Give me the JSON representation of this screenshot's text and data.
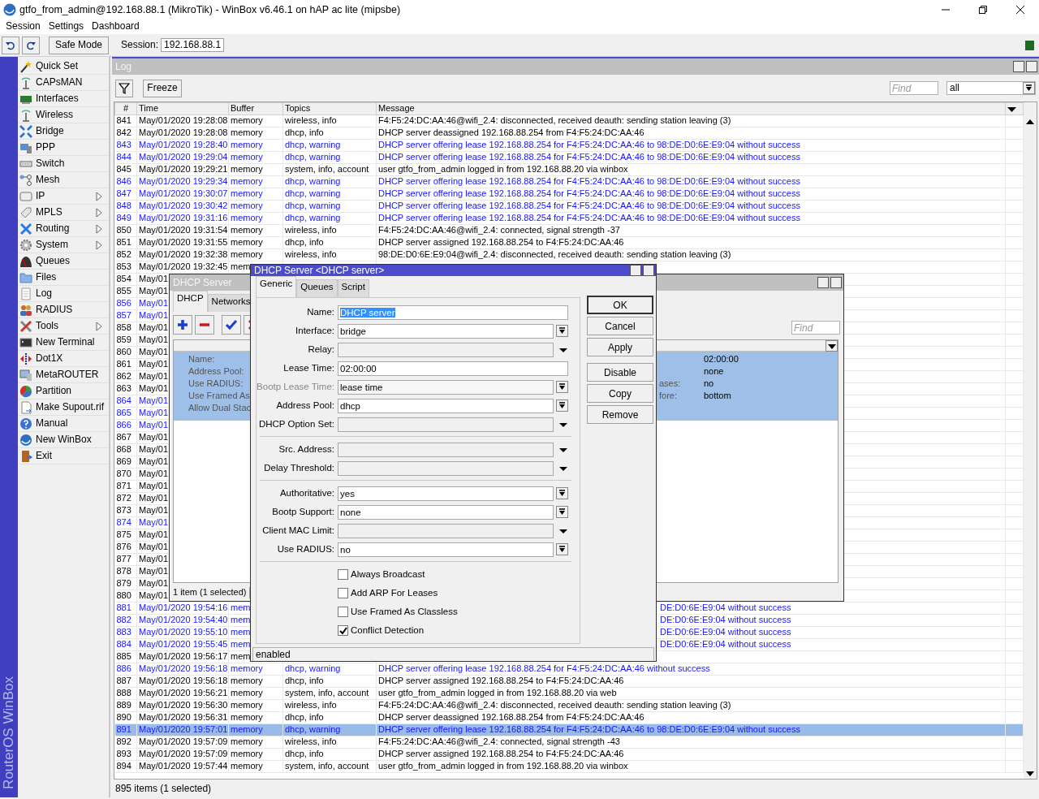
{
  "app": {
    "title": "gtfo_from_admin@192.168.88.1 (MikroTik) - WinBox v6.46.1 on hAP ac lite (mipsbe)",
    "menu": [
      "Session",
      "Settings",
      "Dashboard"
    ],
    "toolbar": {
      "safe_mode": "Safe Mode",
      "session_label": "Session:",
      "session_value": "192.168.88.1"
    },
    "brand_strip": "RouterOS WinBox"
  },
  "sidebar": {
    "items": [
      {
        "label": "Quick Set",
        "submenu": false
      },
      {
        "label": "CAPsMAN",
        "submenu": false
      },
      {
        "label": "Interfaces",
        "submenu": false
      },
      {
        "label": "Wireless",
        "submenu": false
      },
      {
        "label": "Bridge",
        "submenu": false
      },
      {
        "label": "PPP",
        "submenu": false
      },
      {
        "label": "Switch",
        "submenu": false
      },
      {
        "label": "Mesh",
        "submenu": false
      },
      {
        "label": "IP",
        "submenu": true
      },
      {
        "label": "MPLS",
        "submenu": true
      },
      {
        "label": "Routing",
        "submenu": true
      },
      {
        "label": "System",
        "submenu": true
      },
      {
        "label": "Queues",
        "submenu": false
      },
      {
        "label": "Files",
        "submenu": false
      },
      {
        "label": "Log",
        "submenu": false
      },
      {
        "label": "RADIUS",
        "submenu": false
      },
      {
        "label": "Tools",
        "submenu": true
      },
      {
        "label": "New Terminal",
        "submenu": false
      },
      {
        "label": "Dot1X",
        "submenu": false
      },
      {
        "label": "MetaROUTER",
        "submenu": false
      },
      {
        "label": "Partition",
        "submenu": false
      },
      {
        "label": "Make Supout.rif",
        "submenu": false
      },
      {
        "label": "Manual",
        "submenu": false
      },
      {
        "label": "New WinBox",
        "submenu": false
      },
      {
        "label": "Exit",
        "submenu": false
      }
    ]
  },
  "log_window": {
    "title": "Log",
    "freeze": "Freeze",
    "find_placeholder": "Find",
    "filter_value": "all",
    "columns": [
      "#",
      "Time",
      "Buffer",
      "Topics",
      "Message"
    ],
    "status": "895 items (1 selected)",
    "rows": [
      {
        "number": "841",
        "time": "May/01/2020 19:28:08",
        "buffer": "memory",
        "topics": "wireless, info",
        "message": "F4:F5:24:DC:AA:46@wifi_2.4: disconnected, received deauth: sending station leaving (3)",
        "kind": "info",
        "selected": false
      },
      {
        "number": "842",
        "time": "May/01/2020 19:28:08",
        "buffer": "memory",
        "topics": "dhcp, info",
        "message": "DHCP server deassigned 192.168.88.254 from F4:F5:24:DC:AA:46",
        "kind": "info",
        "selected": false
      },
      {
        "number": "843",
        "time": "May/01/2020 19:28:40",
        "buffer": "memory",
        "topics": "dhcp, warning",
        "message": "DHCP server offering lease 192.168.88.254 for F4:F5:24:DC:AA:46 to 98:DE:D0:6E:E9:04 without success",
        "kind": "warning",
        "selected": false
      },
      {
        "number": "844",
        "time": "May/01/2020 19:29:04",
        "buffer": "memory",
        "topics": "dhcp, warning",
        "message": "DHCP server offering lease 192.168.88.254 for F4:F5:24:DC:AA:46 to 98:DE:D0:6E:E9:04 without success",
        "kind": "warning",
        "selected": false
      },
      {
        "number": "845",
        "time": "May/01/2020 19:29:21",
        "buffer": "memory",
        "topics": "system, info, account",
        "message": "user gtfo_from_admin logged in from 192.168.88.20 via winbox",
        "kind": "info",
        "selected": false
      },
      {
        "number": "846",
        "time": "May/01/2020 19:29:34",
        "buffer": "memory",
        "topics": "dhcp, warning",
        "message": "DHCP server offering lease 192.168.88.254 for F4:F5:24:DC:AA:46 to 98:DE:D0:6E:E9:04 without success",
        "kind": "warning",
        "selected": false
      },
      {
        "number": "847",
        "time": "May/01/2020 19:30:07",
        "buffer": "memory",
        "topics": "dhcp, warning",
        "message": "DHCP server offering lease 192.168.88.254 for F4:F5:24:DC:AA:46 to 98:DE:D0:6E:E9:04 without success",
        "kind": "warning",
        "selected": false
      },
      {
        "number": "848",
        "time": "May/01/2020 19:30:42",
        "buffer": "memory",
        "topics": "dhcp, warning",
        "message": "DHCP server offering lease 192.168.88.254 for F4:F5:24:DC:AA:46 to 98:DE:D0:6E:E9:04 without success",
        "kind": "warning",
        "selected": false
      },
      {
        "number": "849",
        "time": "May/01/2020 19:31:16",
        "buffer": "memory",
        "topics": "dhcp, warning",
        "message": "DHCP server offering lease 192.168.88.254 for F4:F5:24:DC:AA:46 to 98:DE:D0:6E:E9:04 without success",
        "kind": "warning",
        "selected": false
      },
      {
        "number": "850",
        "time": "May/01/2020 19:31:54",
        "buffer": "memory",
        "topics": "wireless, info",
        "message": "F4:F5:24:DC:AA:46@wifi_2.4: connected, signal strength -37",
        "kind": "info",
        "selected": false
      },
      {
        "number": "851",
        "time": "May/01/2020 19:31:55",
        "buffer": "memory",
        "topics": "dhcp, info",
        "message": "DHCP server assigned 192.168.88.254 to F4:F5:24:DC:AA:46",
        "kind": "info",
        "selected": false
      },
      {
        "number": "852",
        "time": "May/01/2020 19:32:38",
        "buffer": "memory",
        "topics": "wireless, info",
        "message": "98:DE:D0:6E:E9:04@wifi_2.4: disconnected, received deauth: sending station leaving (3)",
        "kind": "info",
        "selected": false
      },
      {
        "number": "853",
        "time": "May/01/2020 19:32:45",
        "buffer": "mem",
        "kind": "info",
        "selected": false
      },
      {
        "number": "854",
        "time": "May/01",
        "kind": "info",
        "selected": false
      },
      {
        "number": "855",
        "time": "May/01",
        "kind": "info",
        "selected": false
      },
      {
        "number": "856",
        "time": "May/01",
        "kind": "warning",
        "selected": false
      },
      {
        "number": "857",
        "time": "May/01",
        "kind": "warning",
        "selected": false
      },
      {
        "number": "858",
        "time": "May/01",
        "kind": "info",
        "selected": false
      },
      {
        "number": "859",
        "time": "May/01",
        "kind": "info",
        "selected": false
      },
      {
        "number": "860",
        "time": "May/01",
        "kind": "info",
        "selected": false
      },
      {
        "number": "861",
        "time": "May/01",
        "kind": "info",
        "selected": false
      },
      {
        "number": "862",
        "time": "May/01",
        "kind": "info",
        "selected": false
      },
      {
        "number": "863",
        "time": "May/01",
        "kind": "info",
        "selected": false
      },
      {
        "number": "864",
        "time": "May/01",
        "kind": "warning",
        "selected": false
      },
      {
        "number": "865",
        "time": "May/01",
        "kind": "warning",
        "selected": false
      },
      {
        "number": "866",
        "time": "May/01",
        "kind": "warning",
        "selected": false
      },
      {
        "number": "867",
        "time": "May/01",
        "kind": "info",
        "selected": false
      },
      {
        "number": "868",
        "time": "May/01",
        "kind": "info",
        "selected": false
      },
      {
        "number": "869",
        "time": "May/01",
        "kind": "info",
        "selected": false
      },
      {
        "number": "870",
        "time": "May/01",
        "kind": "info",
        "selected": false
      },
      {
        "number": "871",
        "time": "May/01",
        "kind": "info",
        "selected": false
      },
      {
        "number": "872",
        "time": "May/01",
        "kind": "info",
        "selected": false
      },
      {
        "number": "873",
        "time": "May/01",
        "kind": "info",
        "selected": false
      },
      {
        "number": "874",
        "time": "May/01",
        "kind": "warning",
        "selected": false
      },
      {
        "number": "875",
        "time": "May/01",
        "kind": "info",
        "selected": false
      },
      {
        "number": "876",
        "time": "May/01",
        "kind": "info",
        "selected": false
      },
      {
        "number": "877",
        "time": "May/01",
        "kind": "info",
        "selected": false
      },
      {
        "number": "878",
        "time": "May/01",
        "kind": "info",
        "selected": false
      },
      {
        "number": "879",
        "time": "May/01",
        "kind": "info",
        "selected": false
      },
      {
        "number": "880",
        "time": "May/01",
        "kind": "info",
        "selected": false
      },
      {
        "number": "881",
        "time": "May/01/2020 19:54:16",
        "buffer": "mem",
        "message": "DE:D0:6E:E9:04 without success",
        "kind": "warning",
        "selected": false
      },
      {
        "number": "882",
        "time": "May/01/2020 19:54:40",
        "buffer": "mem",
        "message": "DE:D0:6E:E9:04 without success",
        "kind": "warning",
        "selected": false
      },
      {
        "number": "883",
        "time": "May/01/2020 19:55:10",
        "buffer": "mem",
        "message": "DE:D0:6E:E9:04 without success",
        "kind": "warning",
        "selected": false
      },
      {
        "number": "884",
        "time": "May/01/2020 19:55:45",
        "buffer": "mem",
        "message": "DE:D0:6E:E9:04 without success",
        "kind": "warning",
        "selected": false
      },
      {
        "number": "885",
        "time": "May/01/2020 19:56:17",
        "buffer": "mem",
        "kind": "info",
        "selected": false
      },
      {
        "number": "886",
        "time": "May/01/2020 19:56:18",
        "buffer": "memory",
        "topics": "dhcp, warning",
        "message": "DHCP server offering lease 192.168.88.254 for F4:F5:24:DC:AA:46 without success",
        "kind": "warning",
        "selected": false
      },
      {
        "number": "887",
        "time": "May/01/2020 19:56:18",
        "buffer": "memory",
        "topics": "dhcp, info",
        "message": "DHCP server assigned 192.168.88.254 to F4:F5:24:DC:AA:46",
        "kind": "info",
        "selected": false
      },
      {
        "number": "888",
        "time": "May/01/2020 19:56:21",
        "buffer": "memory",
        "topics": "system, info, account",
        "message": "user gtfo_from_admin logged in from 192.168.88.20 via web",
        "kind": "info",
        "selected": false
      },
      {
        "number": "889",
        "time": "May/01/2020 19:56:30",
        "buffer": "memory",
        "topics": "wireless, info",
        "message": "F4:F5:24:DC:AA:46@wifi_2.4: disconnected, received deauth: sending station leaving (3)",
        "kind": "info",
        "selected": false
      },
      {
        "number": "890",
        "time": "May/01/2020 19:56:31",
        "buffer": "memory",
        "topics": "dhcp, info",
        "message": "DHCP server deassigned 192.168.88.254 from F4:F5:24:DC:AA:46",
        "kind": "info",
        "selected": false
      },
      {
        "number": "891",
        "time": "May/01/2020 19:57:01",
        "buffer": "memory",
        "topics": "dhcp, warning",
        "message": "DHCP server offering lease 192.168.88.254 for F4:F5:24:DC:AA:46 to 98:DE:D0:6E:E9:04 without success",
        "kind": "warning",
        "selected": true
      },
      {
        "number": "892",
        "time": "May/01/2020 19:57:09",
        "buffer": "memory",
        "topics": "wireless, info",
        "message": "F4:F5:24:DC:AA:46@wifi_2.4: connected, signal strength -43",
        "kind": "info",
        "selected": false
      },
      {
        "number": "893",
        "time": "May/01/2020 19:57:09",
        "buffer": "memory",
        "topics": "dhcp, info",
        "message": "DHCP server assigned 192.168.88.254 to F4:F5:24:DC:AA:46",
        "kind": "info",
        "selected": false
      },
      {
        "number": "894",
        "time": "May/01/2020 19:57:44",
        "buffer": "memory",
        "topics": "system, info, account",
        "message": "user gtfo_from_admin logged in from 192.168.88.20 via winbox",
        "kind": "info",
        "selected": false
      }
    ]
  },
  "dhcp_server_window": {
    "title": "DHCP Server",
    "tabs": [
      {
        "label": "DHCP",
        "selected": true
      },
      {
        "label": "Networks",
        "selected": false
      }
    ],
    "find_placeholder": "Find",
    "entry_lines": [
      {
        "label": "Name:",
        "value": "02:00:00"
      },
      {
        "label": "Address Pool:",
        "value": "none"
      },
      {
        "label": "Use RADIUS:",
        "right_label": "ases:",
        "value": "no"
      },
      {
        "label": "Use Framed As",
        "right_label": "fore:",
        "value": "bottom"
      },
      {
        "label": "Allow Dual Stac"
      }
    ],
    "status": "1 item (1 selected)"
  },
  "dhcp_server_dialog": {
    "title": "DHCP Server <DHCP server>",
    "tabs": [
      {
        "label": "Generic",
        "selected": true
      },
      {
        "label": "Queues",
        "selected": false
      },
      {
        "label": "Script",
        "selected": false
      }
    ],
    "field_groups": [
      [
        {
          "label": "Name:",
          "value": "DHCP server",
          "kind": "text",
          "highlighted": true,
          "disabled": false
        },
        {
          "label": "Interface:",
          "value": "bridge",
          "kind": "combo",
          "disabled": false
        },
        {
          "label": "Relay:",
          "kind": "dropdown",
          "disabled": false
        },
        {
          "label": "Lease Time:",
          "value": "02:00:00",
          "kind": "text",
          "highlighted": false,
          "disabled": false
        },
        {
          "label": "Bootp Lease Time:",
          "value": "lease time",
          "kind": "combo",
          "disabled": true
        },
        {
          "label": "Address Pool:",
          "value": "dhcp",
          "kind": "combo",
          "disabled": false
        },
        {
          "label": "DHCP Option Set:",
          "kind": "dropdown",
          "disabled": false
        }
      ],
      [
        {
          "label": "Src. Address:",
          "kind": "dropdown",
          "disabled": false
        },
        {
          "label": "Delay Threshold:",
          "kind": "dropdown",
          "disabled": false
        }
      ],
      [
        {
          "label": "Authoritative:",
          "value": "yes",
          "kind": "combo",
          "disabled": false
        },
        {
          "label": "Bootp Support:",
          "value": "none",
          "kind": "combo",
          "disabled": false
        },
        {
          "label": "Client MAC Limit:",
          "kind": "dropdown",
          "disabled": false
        },
        {
          "label": "Use RADIUS:",
          "value": "no",
          "kind": "combo",
          "disabled": false
        }
      ]
    ],
    "checkboxes": [
      {
        "label": "Always Broadcast",
        "checked": false
      },
      {
        "label": "Add ARP For Leases",
        "checked": false
      },
      {
        "label": "Use Framed As Classless",
        "checked": false
      },
      {
        "label": "Conflict Detection",
        "checked": true
      }
    ],
    "button_groups": [
      [
        {
          "label": "OK",
          "default": true
        },
        {
          "label": "Cancel",
          "default": false
        },
        {
          "label": "Apply",
          "default": false
        }
      ],
      [
        {
          "label": "Disable",
          "default": false
        },
        {
          "label": "Copy",
          "default": false
        },
        {
          "label": "Remove",
          "default": false
        }
      ]
    ],
    "status": "enabled"
  }
}
